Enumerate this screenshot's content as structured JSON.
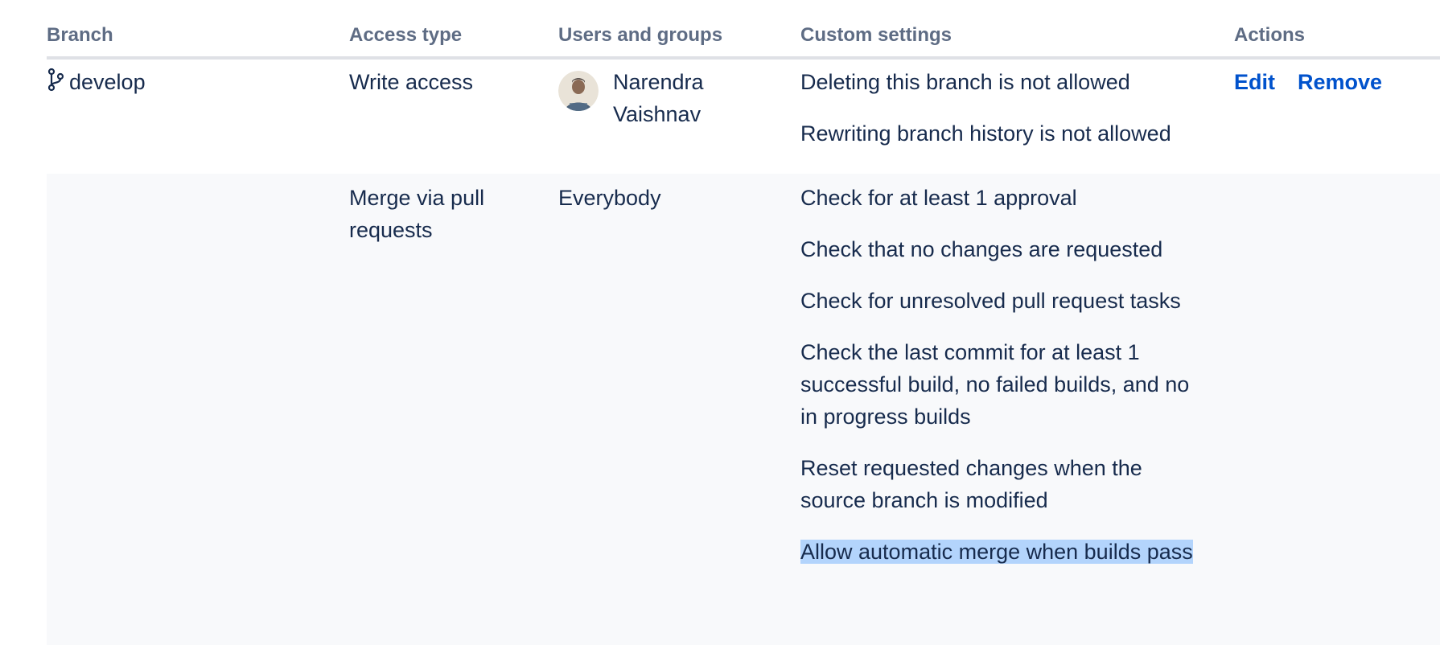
{
  "headers": {
    "branch": "Branch",
    "access_type": "Access type",
    "users_groups": "Users and groups",
    "custom_settings": "Custom settings",
    "actions": "Actions"
  },
  "rows": [
    {
      "branch": "develop",
      "branch_icon": "branch-icon",
      "access_type": "Write access",
      "user": {
        "avatar": "user-avatar",
        "name": "Narendra Vaishnav"
      },
      "settings": [
        "Deleting this branch is not allowed",
        "Rewriting branch history is not allowed"
      ],
      "actions": {
        "edit": "Edit",
        "remove": "Remove"
      }
    },
    {
      "access_type": "Merge via pull requests",
      "users_groups": "Everybody",
      "settings": [
        "Check for at least 1 approval",
        "Check that no changes are requested",
        "Check for unresolved pull request tasks",
        "Check the last commit for at least 1 successful build, no failed builds, and no in progress builds",
        "Reset requested changes when the source branch is modified",
        "Allow automatic merge when builds pass"
      ],
      "highlighted_setting_index": 5
    }
  ],
  "colors": {
    "link": "#0052cc",
    "header_text": "#5e6c84",
    "body_text": "#172b4d",
    "row_alt_bg": "#f8f9fb",
    "selection": "#b3d4fc"
  }
}
